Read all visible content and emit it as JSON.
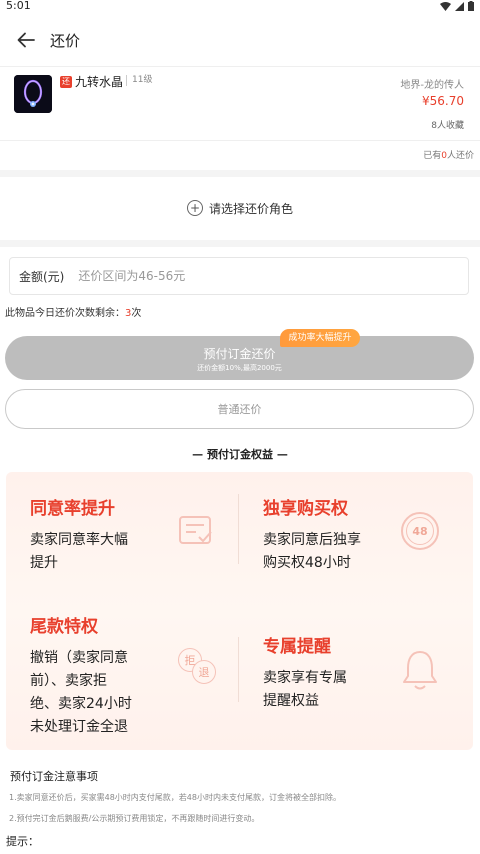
{
  "status_bar": {
    "time": "5:01"
  },
  "header": {
    "title": "还价"
  },
  "product": {
    "tag": "还",
    "name": "九转水晶",
    "level": "11级",
    "server": "地界-龙的传人",
    "price": "¥56.70",
    "favorites": "8人收藏"
  },
  "counter": {
    "prefix": "已有",
    "count": "0",
    "suffix": "人还价"
  },
  "role_select": {
    "label": "请选择还价角色"
  },
  "amount": {
    "label": "金额(元)",
    "placeholder": "还价区间为46-56元"
  },
  "remaining": {
    "prefix": "此物品今日还价次数剩余：",
    "count": "3",
    "suffix": "次"
  },
  "prepay_button": {
    "title": "预付订金还价",
    "subtitle": "还价金额10%,最高2000元",
    "badge": "成功率大幅提升"
  },
  "normal_button": {
    "label": "普通还价"
  },
  "benefits": {
    "heading": "— 预付订金权益 —",
    "items": [
      {
        "title": "同意率提升",
        "desc": [
          "卖家同意率大幅",
          "提升"
        ],
        "icon": "document-check-icon"
      },
      {
        "title": "独享购买权",
        "desc": [
          "卖家同意后独享",
          "购买权48小时"
        ],
        "icon": "48-hour-badge-icon"
      },
      {
        "title": "尾款特权",
        "desc": [
          "撤销（卖家同意",
          "前）、卖家拒",
          "绝、卖家24小时",
          "未处理订金全退"
        ],
        "icon": "refund-icon",
        "icon_text": [
          "拒",
          "退"
        ]
      },
      {
        "title": "专属提醒",
        "desc": [
          "卖家享有专属",
          "提醒权益"
        ],
        "icon": "bell-icon"
      }
    ],
    "icon_48_text": "48"
  },
  "notes": {
    "title": "预付订金注意事项",
    "lines": [
      "1.卖家同意还价后，买家需48小时内支付尾款，若48小时内未支付尾款，订金将被全部扣除。",
      "2.预付完订金后鹅服费/公示期预订费用锁定，不再跟随时间进行变动。"
    ],
    "hint": "提示："
  },
  "colors": {
    "accent": "#e8402d",
    "badge": "#ffa640",
    "disabled": "#bdbdbd"
  }
}
